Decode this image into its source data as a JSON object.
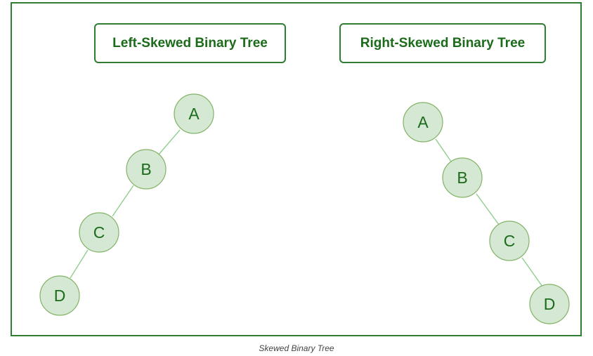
{
  "titles": {
    "left": "Left-Skewed Binary Tree",
    "right": "Right-Skewed Binary Tree"
  },
  "left_tree": {
    "nodes": [
      "A",
      "B",
      "C",
      "D"
    ],
    "edges": [
      [
        "A",
        "B"
      ],
      [
        "B",
        "C"
      ],
      [
        "C",
        "D"
      ]
    ]
  },
  "right_tree": {
    "nodes": [
      "A",
      "B",
      "C",
      "D"
    ],
    "edges": [
      [
        "A",
        "B"
      ],
      [
        "B",
        "C"
      ],
      [
        "C",
        "D"
      ]
    ]
  },
  "caption": "Skewed Binary Tree",
  "colors": {
    "border": "#2e7d32",
    "title_text": "#1b6b1b",
    "node_fill": "#d5e8d4",
    "node_stroke": "#82b366",
    "edge": "#8fce8f"
  }
}
